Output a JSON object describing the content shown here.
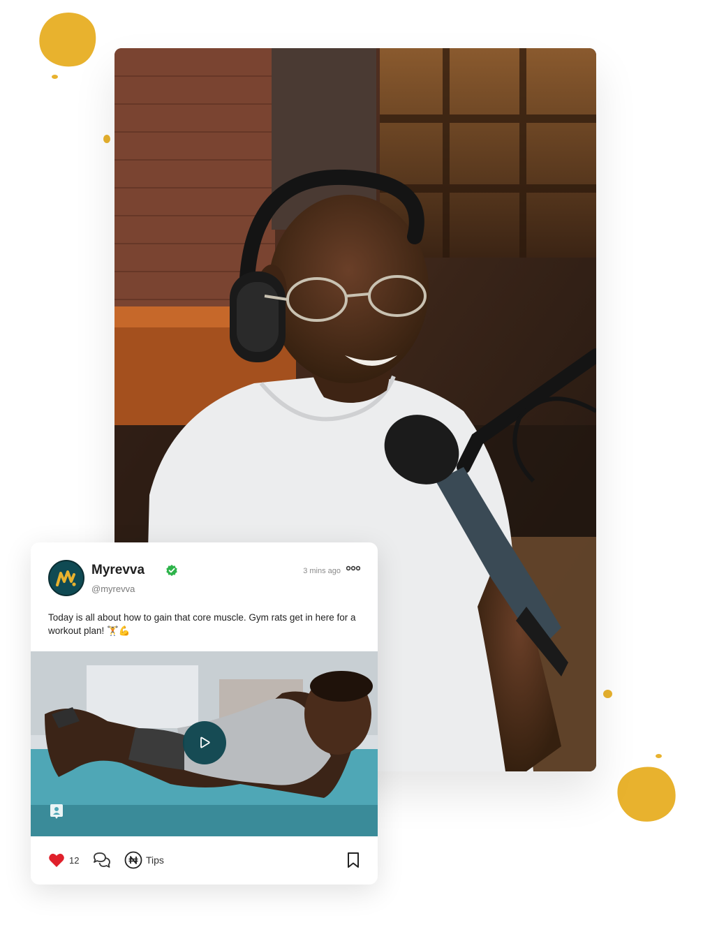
{
  "post": {
    "author_name": "Myrevva",
    "handle": "@myrevva",
    "timestamp": "3 mins ago",
    "text": "Today is all about how to gain that core muscle. Gym rats get in here for a workout plan! 🏋️💪",
    "likes": "12",
    "tips_label": "Tips"
  },
  "icons": {
    "verified": "verified-badge-icon",
    "more": "more-options-icon",
    "play": "play-icon",
    "like": "heart-icon",
    "comment": "comment-icon",
    "tips": "naira-icon",
    "bookmark": "bookmark-icon",
    "profile_tag": "profile-tag-icon"
  },
  "colors": {
    "accent": "#E8B22E",
    "brand_dark": "#0F4A53",
    "verified": "#2DB34A",
    "like": "#E0202B"
  }
}
